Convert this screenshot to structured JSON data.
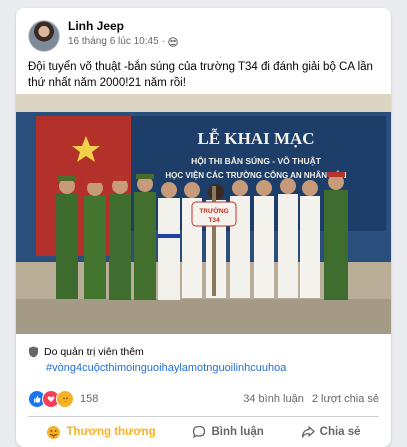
{
  "post": {
    "author": "Linh Jeep",
    "timestamp": "16 tháng 6 lúc 10:45",
    "separator": "·",
    "text": "Đội tuyển võ thuật -bắn súng của trường T34 đi đánh giải bộ CA lần thứ nhất năm 2000!21 năm rồi!"
  },
  "photo": {
    "banner_title": "LỄ KHAI MẠC",
    "banner_line2": "HỘI THI BẮN SÚNG - VÕ THUẬT",
    "banner_line3": "HỌC VIỆN CÁC TRƯỜNG CÔNG AN NHÂN DÂN",
    "sign_line1": "TRƯỜNG",
    "sign_line2": "T34"
  },
  "admin_note": "Do quản trị viên thêm",
  "hashtag": "#vòng4cuộcthimoinguoihaylamotnguoilinhcuuhoa",
  "stats": {
    "reactions": "158",
    "comments": "34 bình luận",
    "shares": "2 lượt chia sẻ"
  },
  "actions": {
    "react_label": "Thương thương",
    "comment_label": "Bình luận",
    "share_label": "Chia sẻ"
  },
  "colors": {
    "accent_blue": "#216fdb",
    "care_yellow": "#f7b125",
    "like_blue": "#1877f2",
    "love_red": "#f33e58"
  }
}
